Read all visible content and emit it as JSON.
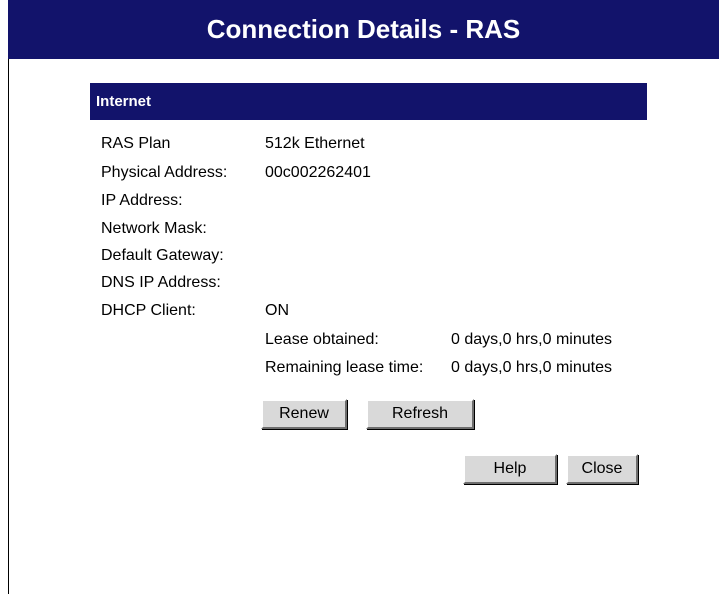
{
  "window": {
    "title": "Connection Details - RAS"
  },
  "section": {
    "title": "Internet"
  },
  "details": {
    "ras_plan_label": "RAS Plan",
    "ras_plan_value": "512k Ethernet",
    "physical_address_label": "Physical Address:",
    "physical_address_value": "00c002262401",
    "ip_address_label": "IP Address:",
    "ip_address_value": "",
    "network_mask_label": "Network Mask:",
    "network_mask_value": "",
    "default_gateway_label": "Default Gateway:",
    "default_gateway_value": "",
    "dns_ip_address_label": "DNS IP Address:",
    "dns_ip_address_value": "",
    "dhcp_client_label": "DHCP Client:",
    "dhcp_client_value": "ON"
  },
  "lease": {
    "obtained_label": "Lease obtained:",
    "obtained_value": "0 days,0 hrs,0 minutes",
    "remaining_label": "Remaining lease time:",
    "remaining_value": "0 days,0 hrs,0 minutes"
  },
  "buttons": {
    "renew": "Renew",
    "refresh": "Refresh",
    "help": "Help",
    "close": "Close"
  },
  "colors": {
    "header_bg": "#12136b",
    "header_text": "#ffffff",
    "button_face": "#d9d9d9"
  }
}
